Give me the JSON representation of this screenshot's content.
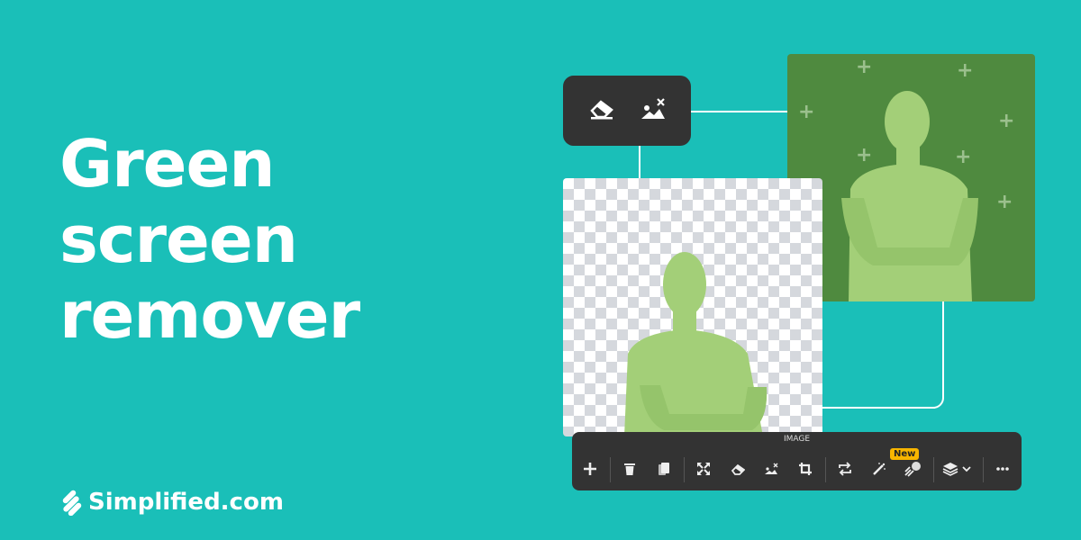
{
  "headline": {
    "lines": [
      "Green",
      "screen",
      "remover"
    ]
  },
  "brand": {
    "name": "Simplified.com"
  },
  "colors": {
    "background": "#1abfb8",
    "green_screen": "#4f8a3f",
    "toolbar": "#333333",
    "badge": "#f7b500"
  },
  "mini_toolbar": {
    "icons": [
      "eraser-icon",
      "remove-background-icon"
    ]
  },
  "toolbar": {
    "title": "IMAGE",
    "badge": "New",
    "icons": [
      "plus-icon",
      "trash-icon",
      "copy-icon",
      "expand-icon",
      "eraser-icon",
      "remove-background-icon",
      "crop-icon",
      "swap-icon",
      "magic-wand-icon",
      "animate-icon",
      "layers-icon",
      "more-icon"
    ]
  }
}
